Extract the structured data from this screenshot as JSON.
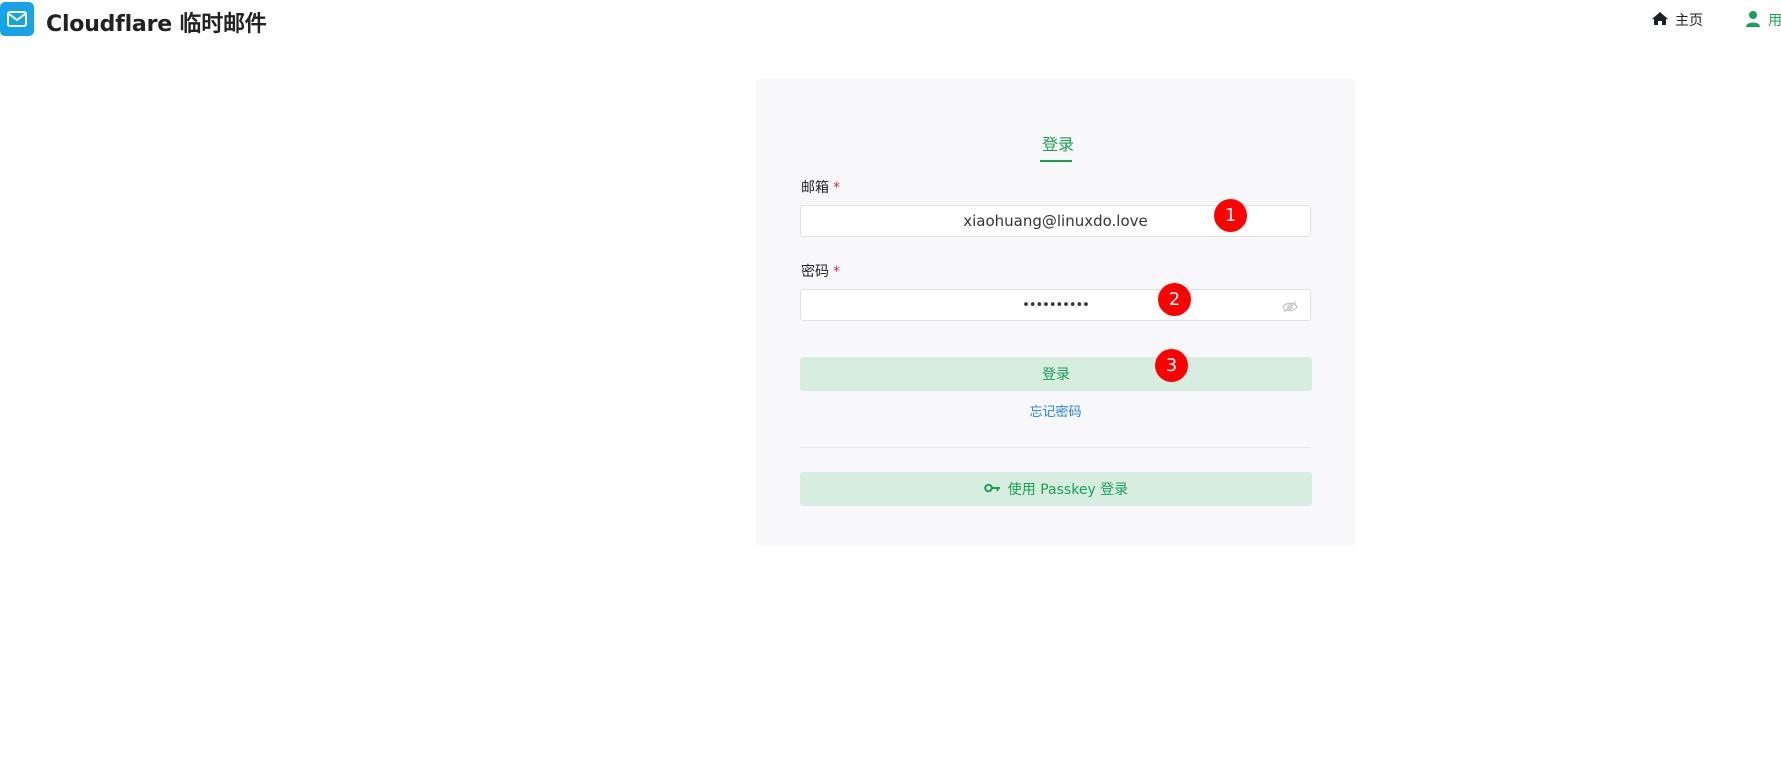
{
  "header": {
    "app_title": "Cloudflare 临时邮件",
    "nav_home": "主页",
    "nav_user": "用"
  },
  "login": {
    "tab_label": "登录",
    "email_label": "邮箱",
    "required_mark": "*",
    "email_value": "xiaohuang@linuxdo.love",
    "password_label": "密码",
    "password_value": "••••••••••",
    "login_button": "登录",
    "forgot_password": "忘记密码",
    "passkey_button": "使用 Passkey 登录"
  },
  "annotations": {
    "step1": "1",
    "step2": "2",
    "step3": "3"
  },
  "colors": {
    "primary": "#18a058",
    "primary_light": "#d6ede0",
    "link": "#2080f0",
    "required": "#d03050",
    "logo_bg": "#16a4e6",
    "badge": "#ff0000",
    "card_bg": "#f8f8fa"
  },
  "icons": {
    "logo": "mail-icon",
    "home": "home-icon",
    "user": "user-icon",
    "eye": "eye-icon",
    "key": "key-icon"
  }
}
